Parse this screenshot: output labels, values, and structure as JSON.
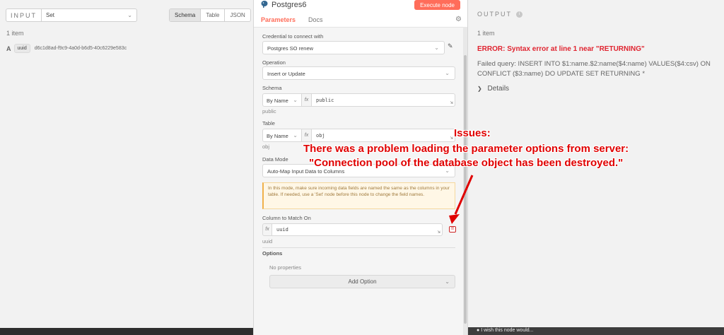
{
  "input": {
    "label": "INPUT",
    "node_select": "Set",
    "tabs": [
      "Schema",
      "Table",
      "JSON"
    ],
    "active_tab": "Schema",
    "count": "1 item",
    "fields": [
      {
        "type_icon": "A",
        "name": "uuid",
        "value": "d6c1d8ad-f9c9-4a0d-b6d5-40c6229e583c"
      }
    ]
  },
  "node": {
    "title": "Postgres6",
    "execute_label": "Execute node",
    "tabs": [
      "Parameters",
      "Docs"
    ],
    "active_tab": "Parameters",
    "credential": {
      "label": "Credential to connect with",
      "value": "Postgres SO renew"
    },
    "operation": {
      "label": "Operation",
      "value": "Insert or Update"
    },
    "schema": {
      "label": "Schema",
      "mode": "By Name",
      "fx": "fx",
      "value": "public",
      "hint": "public"
    },
    "table": {
      "label": "Table",
      "mode": "By Name",
      "fx": "fx",
      "value": "obj",
      "hint": "obj"
    },
    "data_mode": {
      "label": "Data Mode",
      "value": "Auto-Map Input Data to Columns"
    },
    "notice": "In this mode, make sure incoming data fields are named the same as the columns in your table. If needed, use a 'Set' node before this node to change the field names.",
    "column_match": {
      "label": "Column to Match On",
      "fx": "fx",
      "value": "uuid",
      "hint": "uuid"
    },
    "options": {
      "label": "Options",
      "empty": "No properties",
      "add_label": "Add Option"
    }
  },
  "output": {
    "label": "OUTPUT",
    "count": "1 item",
    "error_title": "ERROR: Syntax error at line 1 near \"RETURNING\"",
    "error_query": "Failed query: INSERT INTO $1:name.$2:name($4:name) VALUES($4:csv) ON CONFLICT ($3:name) DO UPDATE SET RETURNING *",
    "details_label": "Details"
  },
  "bottom": {
    "text": "I wish this node would..."
  },
  "annotation": {
    "line1": "Issues:",
    "line2": "There was a problem loading the parameter options from server:",
    "line3": "\"Connection pool of the database object has been destroyed.\"",
    "color": "#e00000"
  },
  "colors": {
    "accent": "#ff6d5a",
    "error": "#e0232f",
    "postgres": "#336791"
  },
  "icons": [
    "postgres-elephant-icon",
    "gear-icon",
    "pencil-icon",
    "chevron-down-icon",
    "expand-icon",
    "warning-icon",
    "info-icon",
    "chevron-right-icon",
    "lightbulb-icon"
  ]
}
